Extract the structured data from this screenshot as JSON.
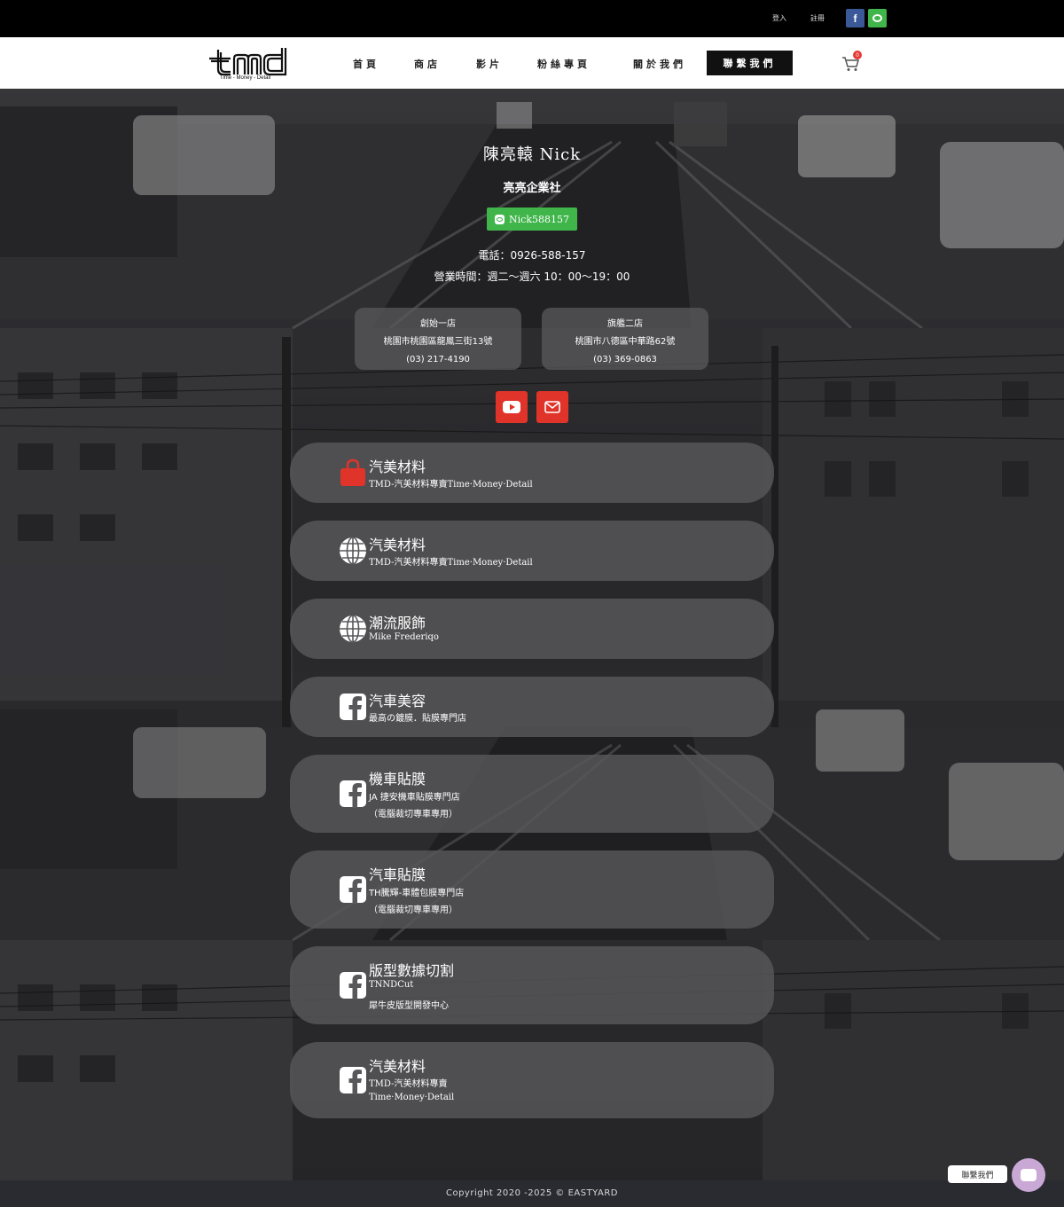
{
  "topbar": {
    "login_label": "登入",
    "register_label": "註冊",
    "facebook_icon": "facebook-icon",
    "line_icon": "line-icon"
  },
  "brand": {
    "logo_text": "tmd",
    "tagline": "Time - Money - Detail"
  },
  "nav": {
    "items": [
      "首頁",
      "商店",
      "影片",
      "粉絲專頁",
      "關於我們"
    ],
    "contact_label": "聯繫我們",
    "cart_count": "0"
  },
  "profile": {
    "name": "陳亮轅 Nick",
    "company": "亮亮企業社",
    "line_id": "Nick588157",
    "phone": "電話：0926-588-157",
    "hours": "營業時間：週二～週六 10：00～19：00"
  },
  "stores": [
    {
      "name": "創始一店",
      "address": "桃園市桃園區龍鳳三街13號",
      "phone": "(03) 217-4190"
    },
    {
      "name": "旗艦二店",
      "address": "桃園市八德區中華路62號",
      "phone": "(03) 369-0863"
    }
  ],
  "social": {
    "youtube_icon": "youtube-icon",
    "mail_icon": "mail-icon"
  },
  "links": [
    {
      "icon": "shopping-bag-icon",
      "title": "汽美材料",
      "sub": "TMD-汽美材料專賣Time·Money·Detail",
      "sub2": ""
    },
    {
      "icon": "globe-icon",
      "title": "汽美材料",
      "sub": "TMD-汽美材料專賣Time·Money·Detail",
      "sub2": ""
    },
    {
      "icon": "globe-icon",
      "title": "潮流服飾",
      "sub": "Mike Frederiqo",
      "sub2": ""
    },
    {
      "icon": "facebook-icon",
      "title": "汽車美容",
      "sub": "最高の鍍膜．貼膜專門店",
      "sub2": ""
    },
    {
      "icon": "facebook-icon",
      "title": "機車貼膜",
      "sub": "JA 捷安機車貼膜專門店",
      "sub2": "（電腦裁切專車專用）"
    },
    {
      "icon": "facebook-icon",
      "title": "汽車貼膜",
      "sub": "TH騰輝-車體包膜專門店",
      "sub2": "（電腦裁切專車專用）"
    },
    {
      "icon": "facebook-icon",
      "title": "版型數據切割",
      "sub": "TNNDCut",
      "sub2": "犀牛皮版型開發中心"
    },
    {
      "icon": "facebook-icon",
      "title": "汽美材料",
      "sub": "TMD-汽美材料專賣",
      "sub2": "Time·Money·Detail"
    }
  ],
  "footer": {
    "copyright": "Copyright 2020 -2025 © EASTYARD",
    "chat_label": "聯繫我們"
  },
  "colors": {
    "line_green": "#3fb54a",
    "facebook_blue": "#3b5998",
    "social_red": "#e0342b",
    "cart_badge": "#e53935"
  }
}
